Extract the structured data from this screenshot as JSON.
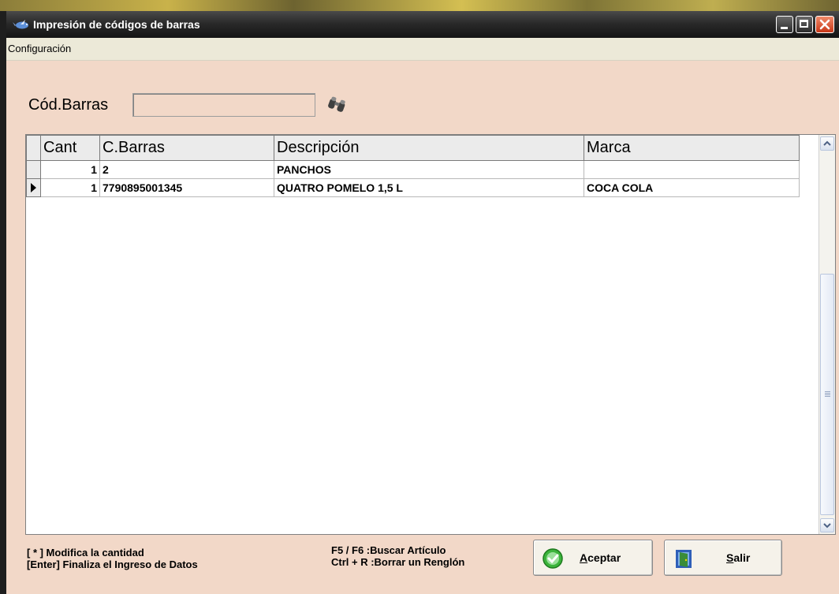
{
  "window": {
    "title": "Impresión de códigos de barras"
  },
  "menu": {
    "items": [
      "Configuración"
    ]
  },
  "search": {
    "label": "Cód.Barras",
    "value": ""
  },
  "grid": {
    "columns": [
      "Cant",
      "C.Barras",
      "Descripción",
      "Marca"
    ],
    "rows": [
      {
        "cant": "1",
        "barras": "2",
        "descripcion": "PANCHOS",
        "marca": ""
      },
      {
        "cant": "1",
        "barras": "7790895001345",
        "descripcion": "QUATRO POMELO 1,5 L",
        "marca": "COCA COLA",
        "current": true
      }
    ]
  },
  "hints": {
    "line1": "[ * ]  Modifica la cantidad",
    "line2": "[Enter]  Finaliza el Ingreso de Datos",
    "line3": "F5 / F6 :Buscar Artículo",
    "line4": "Ctrl + R :Borrar un Renglón"
  },
  "buttons": {
    "ok": {
      "accel": "A",
      "rest": "ceptar"
    },
    "exit": {
      "accel": "S",
      "rest": "alir"
    }
  },
  "icons": {
    "title": "app-bird-icon",
    "search": "binoculars-icon",
    "ok": "green-check-icon",
    "exit": "exit-door-icon"
  },
  "colors": {
    "window_bg": "#f2d8c8",
    "titlebar": "#2a2a2a",
    "close_button": "#d8482a"
  }
}
